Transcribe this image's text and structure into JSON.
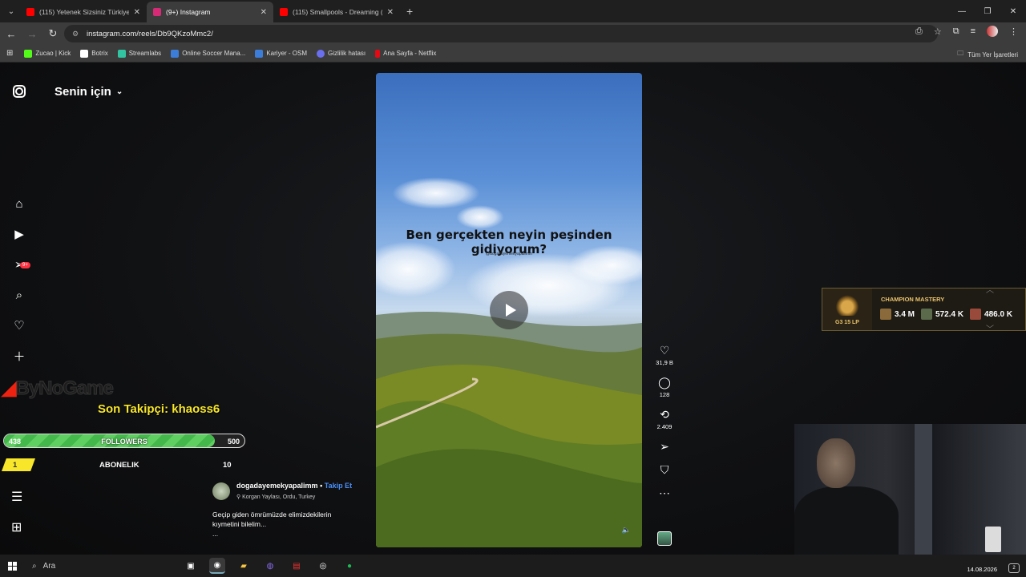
{
  "browser": {
    "tabs": [
      {
        "title": "(115) Yetenek Sizsiniz Türkiye'nin",
        "favicon_color": "#ff0000",
        "active": false
      },
      {
        "title": "(9+) Instagram",
        "favicon_color": "#d62976",
        "active": true
      },
      {
        "title": "(115) Smallpools - Dreaming (O",
        "favicon_color": "#ff0000",
        "active": false
      }
    ],
    "url": "instagram.com/reels/Db9QKzoMmc2/",
    "bookmarks": [
      {
        "label": "Zucao | Kick",
        "color": "#53fc18"
      },
      {
        "label": "Botrix",
        "color": "#ffffff"
      },
      {
        "label": "Streamlabs",
        "color": "#31c3a2"
      },
      {
        "label": "Online Soccer Mana...",
        "color": "#3c7dd9"
      },
      {
        "label": "Kariyer - OSM",
        "color": "#3c7dd9"
      },
      {
        "label": "Gizlilik hatası",
        "color": "#6a6ff0"
      },
      {
        "label": "Ana Sayfa - Netflix",
        "color": "#e50914"
      }
    ],
    "all_bookmarks": "Tüm Yer İşaretleri"
  },
  "instagram": {
    "feed_title": "Senin için",
    "notification_badge": "9+",
    "reel": {
      "overlay_text": "Ben gerçekten neyin peşinden gidiyorum?",
      "handle_watermark": "@dogadayemekyapalimm"
    },
    "actions": {
      "likes": "31,9 B",
      "comments": "128",
      "reposts": "2.409"
    },
    "author": {
      "username": "dogadayemekyapalimm",
      "separator": "•",
      "follow_label": "Takip Et",
      "location": "Korgan Yaylası, Ordu, Turkey"
    },
    "caption_line1": "Geçip giden ömrümüzde elimizdekilerin",
    "caption_line2": "kıymetini bilelim...",
    "caption_more": "..."
  },
  "stream_overlay": {
    "logo_text": "ByNoGame",
    "last_follower": "Son Takipçi: khaoss6",
    "followers": {
      "current": "438",
      "label": "FOLLOWERS",
      "goal": "500",
      "progress": 0.876
    },
    "subscription": {
      "current": "1",
      "label": "ABONELIK",
      "goal": "10"
    },
    "champion_mastery": {
      "title": "CHAMPION MASTERY",
      "rank": "G3 15 LP",
      "stats": [
        "3.4 M",
        "572.4 K",
        "486.0 K"
      ]
    }
  },
  "taskbar": {
    "search_placeholder": "Ara",
    "date": "14.08.2026",
    "notification_count": "2"
  }
}
